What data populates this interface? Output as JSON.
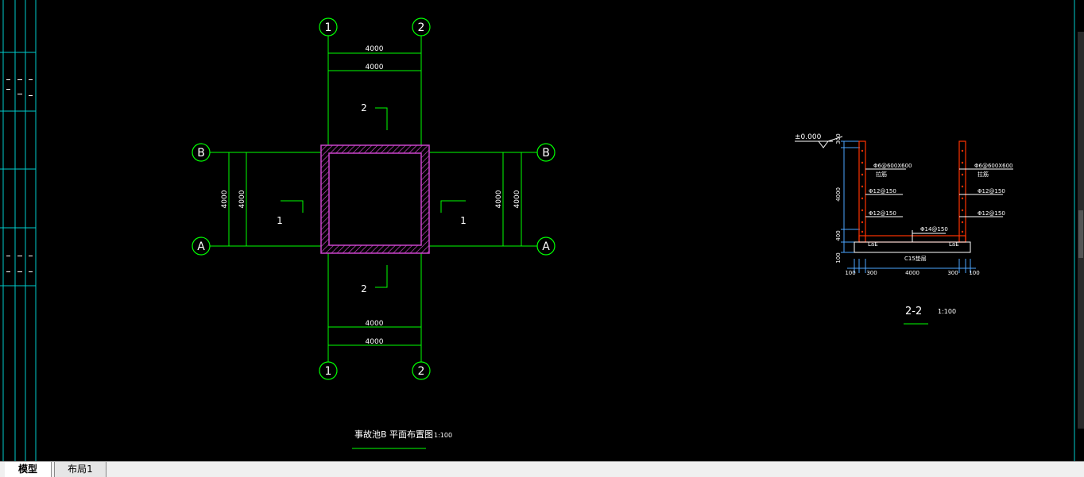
{
  "colors": {
    "background": "#000000",
    "grid": "#00ff00",
    "wall": "#cc44cc",
    "rebar": "#ff3300",
    "dimension": "#4da6ff",
    "text": "#ffffff",
    "frame": "#00cccc"
  },
  "plan": {
    "title": "事故池B 平面布置图",
    "scale": "1:100",
    "axes": {
      "col1": "1",
      "col2": "2",
      "rowA": "A",
      "rowB": "B"
    },
    "dims": {
      "top1": "4000",
      "top2": "4000",
      "bottom1": "4000",
      "bottom2": "4000",
      "left1": "4000",
      "left2": "4000",
      "right1": "4000",
      "right2": "4000"
    },
    "sections": {
      "top": "2",
      "bottom": "2",
      "left": "1",
      "right": "1"
    }
  },
  "section": {
    "title": "2-2",
    "scale": "1:100",
    "level": "±0.000",
    "left_dims": [
      "300",
      "4000",
      "400",
      "100"
    ],
    "bottom_dims": [
      "100",
      "300",
      "4000",
      "300",
      "100"
    ],
    "labels": {
      "left_top": "Φ6@600X600",
      "left_top_sub": "拉筋",
      "right_top": "Φ6@600X600",
      "right_top_sub": "拉筋",
      "left_mid1": "Φ12@150",
      "left_mid2": "Φ12@150",
      "right_mid1": "Φ12@150",
      "right_mid2": "Φ12@150",
      "bottom_rebar": "Φ14@150",
      "lae_left": "LaE",
      "lae_right": "LaE",
      "base": "C15垫层"
    }
  },
  "tabs": {
    "model": "模型",
    "layout": "布局1"
  }
}
